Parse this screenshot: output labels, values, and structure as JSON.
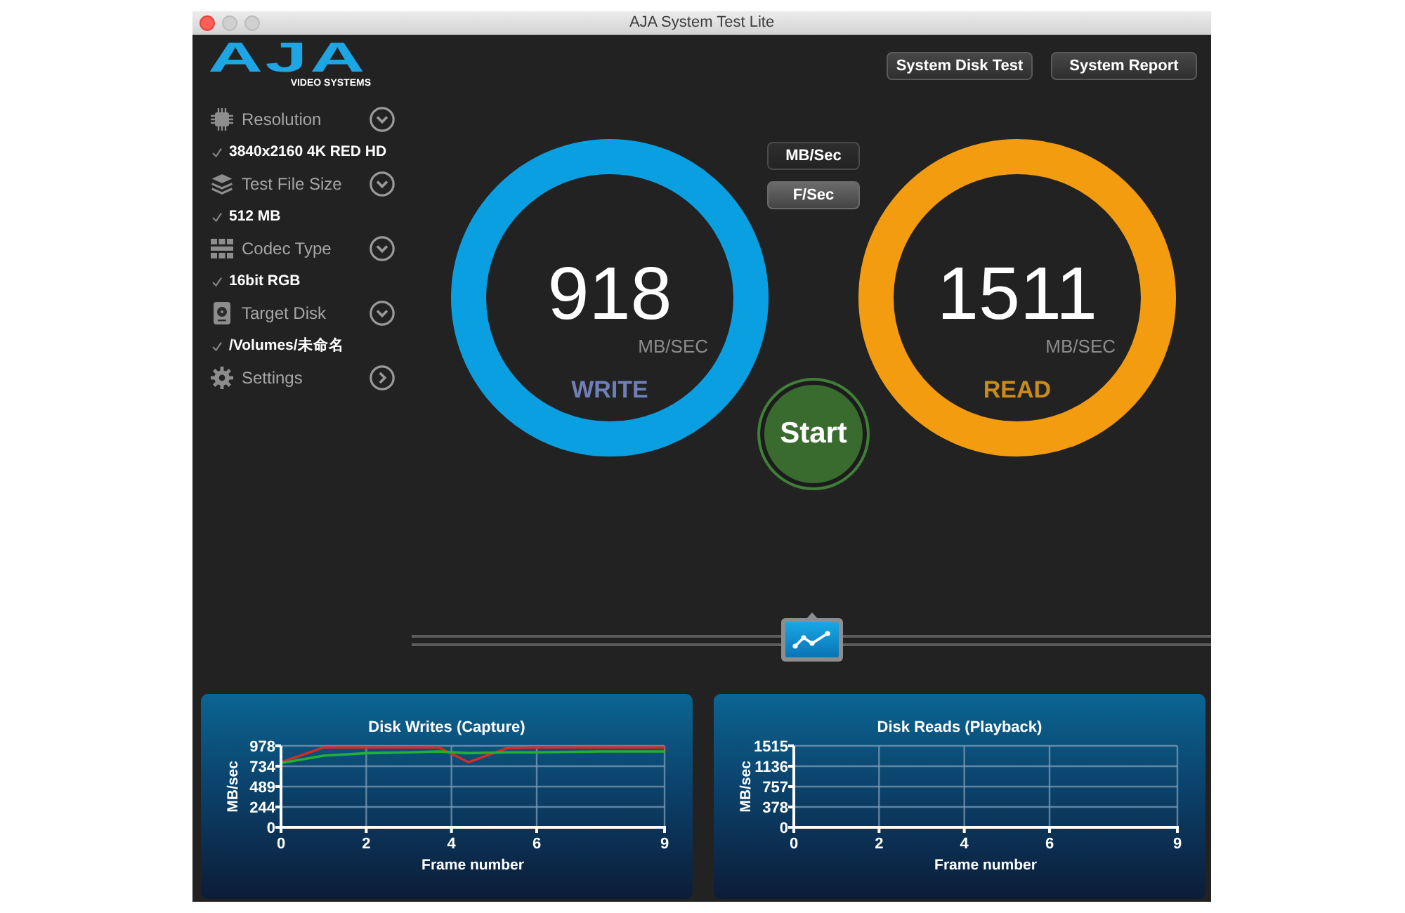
{
  "window": {
    "title": "AJA System Test Lite"
  },
  "logo": {
    "mark": "AJA",
    "tagline": "VIDEO SYSTEMS"
  },
  "sidebar": {
    "items": [
      {
        "label": "Resolution",
        "expanded": true,
        "value": {
          "text": "3840x2160 4K RED HD",
          "checked": true
        }
      },
      {
        "label": "Test File Size",
        "expanded": true,
        "value": {
          "text": "512 MB",
          "checked": true
        }
      },
      {
        "label": "Codec Type",
        "expanded": true,
        "value": {
          "text": "16bit RGB",
          "checked": true
        }
      },
      {
        "label": "Target Disk",
        "expanded": true,
        "value": {
          "text": "/Volumes/未命名",
          "checked": true
        }
      },
      {
        "label": "Settings",
        "expanded": false
      }
    ]
  },
  "toolbar": {
    "buttons": [
      "System Disk Test",
      "System Report"
    ]
  },
  "unit_toggle": [
    {
      "label": "MB/Sec",
      "selected": true
    },
    {
      "label": "F/Sec",
      "selected": false
    }
  ],
  "gauges": [
    {
      "value": "918",
      "unit": "MB/SEC",
      "label": "WRITE",
      "color": "#0a9fe0"
    },
    {
      "value": "1511",
      "unit": "MB/SEC",
      "label": "READ",
      "color": "#f39c0f"
    }
  ],
  "start_button": {
    "label": "Start"
  },
  "charts": [
    {
      "chart_data": {
        "type": "line",
        "title": "Disk Writes (Capture)",
        "xlabel": "Frame number",
        "ylabel": "MB/sec",
        "x": [
          0,
          1,
          2,
          3,
          3.7,
          4.4,
          5.3,
          6,
          7.5,
          9
        ],
        "series": [
          {
            "color": "#d42a2a",
            "values": [
              780,
              960,
              960,
              960,
              960,
              780,
              950,
              960,
              960,
              960
            ]
          },
          {
            "color": "#22b033",
            "values": [
              770,
              860,
              890,
              900,
              910,
              890,
              900,
              900,
              910,
              910
            ]
          }
        ],
        "xlim": [
          0,
          9
        ],
        "ylim": [
          0,
          978
        ],
        "xticks": [
          0,
          2,
          4,
          6,
          9
        ],
        "yticks": [
          0,
          244,
          489,
          734,
          978
        ],
        "grid": true
      }
    },
    {
      "chart_data": {
        "type": "line",
        "title": "Disk Reads (Playback)",
        "xlabel": "Frame number",
        "ylabel": "MB/sec",
        "xlim": [
          0,
          9
        ],
        "ylim": [
          0,
          1515
        ],
        "xticks": [
          0,
          2,
          4,
          6,
          9
        ],
        "yticks": [
          0,
          378,
          757,
          1136,
          1515
        ],
        "grid": true
      }
    }
  ]
}
